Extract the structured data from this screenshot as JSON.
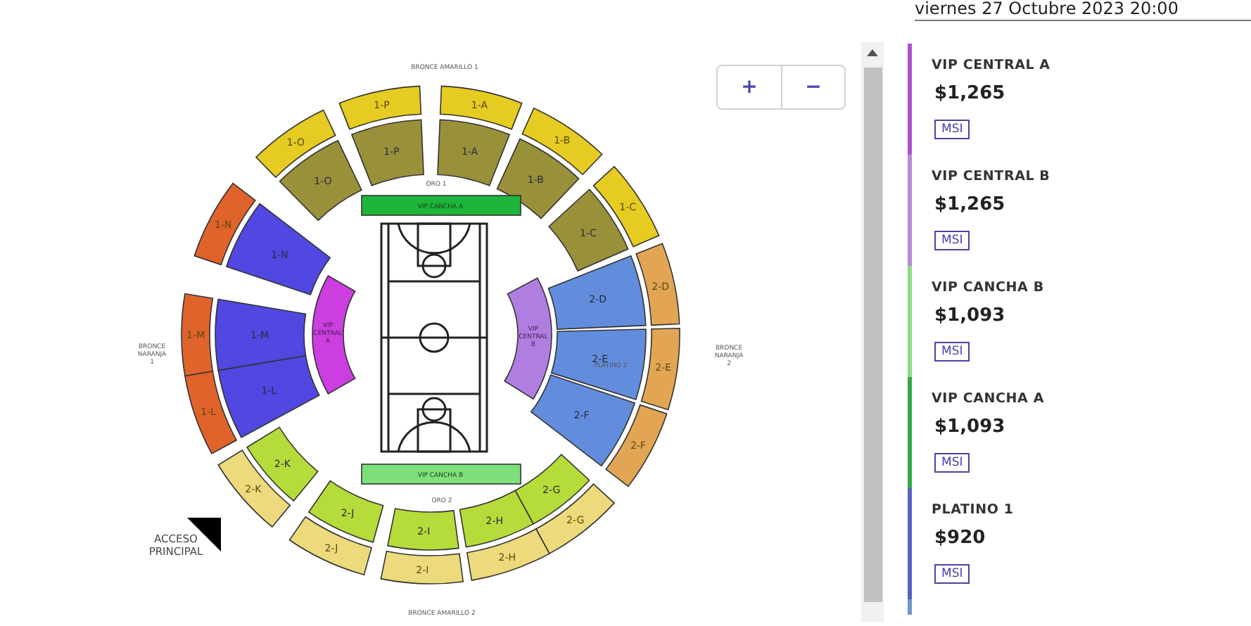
{
  "event_date": "viernes 27 Octubre 2023 20:00",
  "zoom_buttons": [
    "+",
    "−"
  ],
  "map": {
    "outer_ring": [
      {
        "label": "1-A",
        "color": "#e6cb22"
      },
      {
        "label": "1-B",
        "color": "#e6cb22"
      },
      {
        "label": "1-C",
        "color": "#e6cb22"
      },
      {
        "label": "2-D",
        "color": "#e2a553"
      },
      {
        "label": "2-E",
        "color": "#e2a553"
      },
      {
        "label": "2-F",
        "color": "#e2a553"
      },
      {
        "label": "2-G",
        "color": "#ecda7c"
      },
      {
        "label": "2-H",
        "color": "#ecda7c"
      },
      {
        "label": "2-I",
        "color": "#ecda7c"
      },
      {
        "label": "2-J",
        "color": "#ecda7c"
      },
      {
        "label": "2-K",
        "color": "#ecda7c"
      },
      {
        "label": "1-L",
        "color": "#e0632c"
      },
      {
        "label": "1-M",
        "color": "#e0632c"
      },
      {
        "label": "1-N",
        "color": "#e0632c"
      },
      {
        "label": "1-O",
        "color": "#e6cb22"
      },
      {
        "label": "1-P",
        "color": "#e6cb22"
      }
    ],
    "inner_ring": [
      {
        "label": "1-A",
        "color": "#99913a"
      },
      {
        "label": "1-B",
        "color": "#99913a"
      },
      {
        "label": "1-C",
        "color": "#99913a"
      },
      {
        "label": "2-D",
        "color": "#628ddc"
      },
      {
        "label": "2-E",
        "color": "#628ddc"
      },
      {
        "label": "2-F",
        "color": "#628ddc"
      },
      {
        "label": "2-G",
        "color": "#b5dc3a"
      },
      {
        "label": "2-H",
        "color": "#b5dc3a"
      },
      {
        "label": "2-I",
        "color": "#b5dc3a"
      },
      {
        "label": "2-J",
        "color": "#b5dc3a"
      },
      {
        "label": "2-K",
        "color": "#b5dc3a"
      },
      {
        "label": "1-L",
        "color": "#5048e0"
      },
      {
        "label": "1-M",
        "color": "#5048e0"
      },
      {
        "label": "1-N",
        "color": "#5048e0"
      },
      {
        "label": "1-O",
        "color": "#99913a"
      },
      {
        "label": "1-P",
        "color": "#99913a"
      }
    ],
    "vip_zones": [
      {
        "label": "VIP CANCHA A",
        "color": "#1db53a"
      },
      {
        "label": "VIP CANCHA B",
        "color": "#7ee07a"
      },
      {
        "label": "VIP CENTRAL A",
        "color": "#cc3ee0"
      },
      {
        "label": "VIP CENTRAL B",
        "color": "#b07ee0"
      }
    ],
    "area_labels": [
      "BRONCE AMARILLO 1",
      "ORO 1",
      "BRONCE NARANJA 1",
      "BRONCE NARANJA 2",
      "PLATINO 2",
      "ORO 2",
      "BRONCE AMARILLO 2"
    ],
    "access_label": "ACCESO PRINCIPAL"
  },
  "price_list": [
    {
      "name": "VIP CENTRAL A",
      "price": "$1,265",
      "badge": "MSI",
      "color": "#b24fd0"
    },
    {
      "name": "VIP CENTRAL B",
      "price": "$1,265",
      "badge": "MSI",
      "color": "#b48ad8"
    },
    {
      "name": "VIP CANCHA B",
      "price": "$1,093",
      "badge": "MSI",
      "color": "#8fdc86"
    },
    {
      "name": "VIP CANCHA A",
      "price": "$1,093",
      "badge": "MSI",
      "color": "#35a845"
    },
    {
      "name": "PLATINO 1",
      "price": "$920",
      "badge": "MSI",
      "color": "#5660c0"
    },
    {
      "color": "#6e98c8"
    }
  ]
}
